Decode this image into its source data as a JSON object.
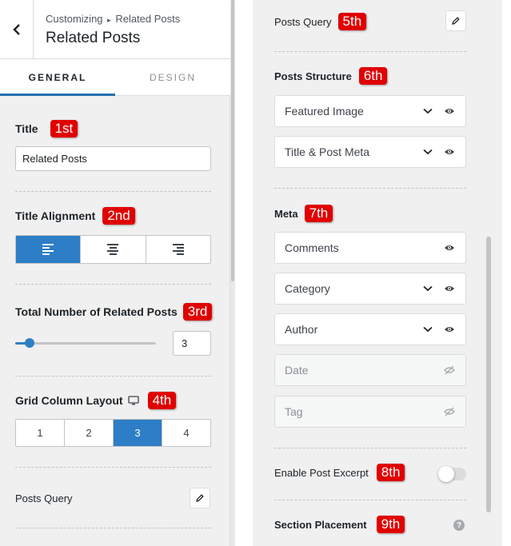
{
  "header": {
    "breadcrumb_root": "Customizing",
    "breadcrumb_sep": "▸",
    "breadcrumb_current": "Related Posts",
    "title": "Related Posts"
  },
  "tabs": [
    {
      "label": "GENERAL",
      "active": true
    },
    {
      "label": "DESIGN",
      "active": false
    }
  ],
  "badges": [
    "1st",
    "2nd",
    "3rd",
    "4th",
    "5th",
    "6th",
    "7th",
    "8th",
    "9th"
  ],
  "left": {
    "title_label": "Title",
    "title_value": "Related Posts",
    "alignment_label": "Title Alignment",
    "alignment_selected": "left",
    "total_label": "Total Number of Related Posts",
    "total_value": "3",
    "total_slider_fraction": 0.1,
    "grid_label": "Grid Column Layout",
    "grid_options": [
      "1",
      "2",
      "3",
      "4"
    ],
    "grid_selected": "3",
    "posts_query_label": "Posts Query"
  },
  "right": {
    "posts_query_label": "Posts Query",
    "posts_structure_label": "Posts Structure",
    "structure_items": [
      {
        "label": "Featured Image"
      },
      {
        "label": "Title & Post Meta"
      }
    ],
    "meta_label": "Meta",
    "meta_items": [
      {
        "label": "Comments",
        "enabled": true
      },
      {
        "label": "Category",
        "enabled": true
      },
      {
        "label": "Author",
        "enabled": true
      },
      {
        "label": "Date",
        "enabled": false
      },
      {
        "label": "Tag",
        "enabled": false
      }
    ],
    "excerpt_label": "Enable Post Excerpt",
    "excerpt_enabled": false,
    "placement_label": "Section Placement",
    "help_glyph": "?"
  },
  "colors": {
    "accent": "#2d7ec6",
    "badge": "#e00000"
  }
}
